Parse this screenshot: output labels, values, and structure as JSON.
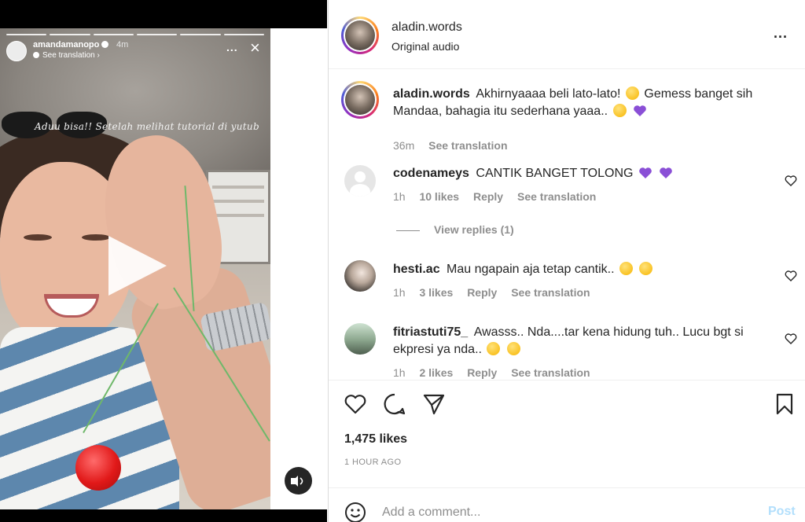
{
  "story": {
    "username": "amandamanopo",
    "time": "4m",
    "see_translation": "See translation",
    "more": "...",
    "close": "×",
    "overlay_text": "Aduu bisa!! Setelah melihat tutorial di yutub"
  },
  "post": {
    "header": {
      "username": "aladin.words",
      "subtitle": "Original audio",
      "more": "..."
    },
    "caption": {
      "username": "aladin.words",
      "text_before": "Akhirnyaaaa beli lato-lato!",
      "text_mid": "Gemess banget sih Mandaa, bahagia itu sederhana yaaa..",
      "time": "36m",
      "see_translation": "See translation"
    },
    "comments": [
      {
        "username": "codenameys",
        "text": "CANTIK BANGET TOLONG",
        "time": "1h",
        "likes": "10 likes",
        "reply": "Reply",
        "see_translation": "See translation"
      },
      {
        "username": "hesti.ac",
        "text": "Mau ngapain aja tetap cantik..",
        "time": "1h",
        "likes": "3 likes",
        "reply": "Reply",
        "see_translation": "See translation"
      },
      {
        "username": "fitriastuti75_",
        "text": "Awasss.. Nda....tar kena hidung tuh.. Lucu bgt si ekpresi ya nda..",
        "time": "1h",
        "likes": "2 likes",
        "reply": "Reply",
        "see_translation": "See translation"
      }
    ],
    "view_replies": "View replies (1)",
    "likes_count": "1,475 likes",
    "posted_ago": "1 HOUR AGO",
    "add_comment_placeholder": "Add a comment...",
    "post_label": "Post"
  },
  "icons": {
    "like": "heart-icon",
    "comment": "comment-icon",
    "share": "share-icon",
    "save": "bookmark-icon",
    "emoji": "smiley-icon",
    "play": "play-icon",
    "sound": "speaker-icon"
  },
  "colors": {
    "accent_link": "#b2dffc",
    "muted_text": "#8e8e8e",
    "heart_purple": "#8a4fd6"
  }
}
